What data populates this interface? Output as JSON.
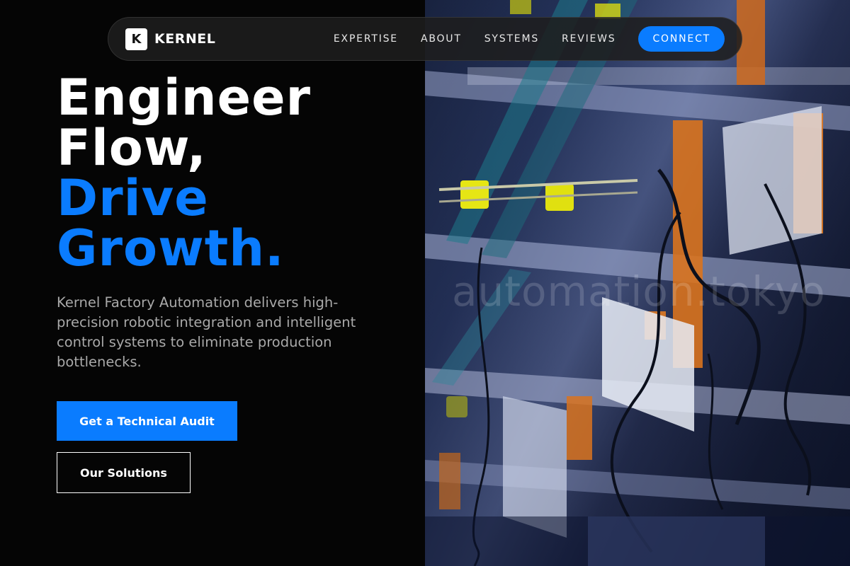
{
  "nav": {
    "logo_letter": "K",
    "brand": "KERNEL",
    "links": [
      "EXPERTISE",
      "ABOUT",
      "SYSTEMS",
      "REVIEWS"
    ],
    "cta": "CONNECT"
  },
  "hero": {
    "title_line1": "Engineer",
    "title_line2": "Flow,",
    "title_line3": "Drive",
    "title_line4": "Growth.",
    "description": "Kernel Factory Automation delivers high-precision robotic integration and intelligent control systems to eliminate production bottlenecks.",
    "primary_button": "Get a Technical Audit",
    "secondary_button": "Our Solutions"
  },
  "image": {
    "watermark": "automation.tokyo"
  },
  "colors": {
    "accent": "#0a7cff",
    "background": "#050505",
    "text": "#ffffff",
    "muted_text": "#a9a9a9"
  }
}
